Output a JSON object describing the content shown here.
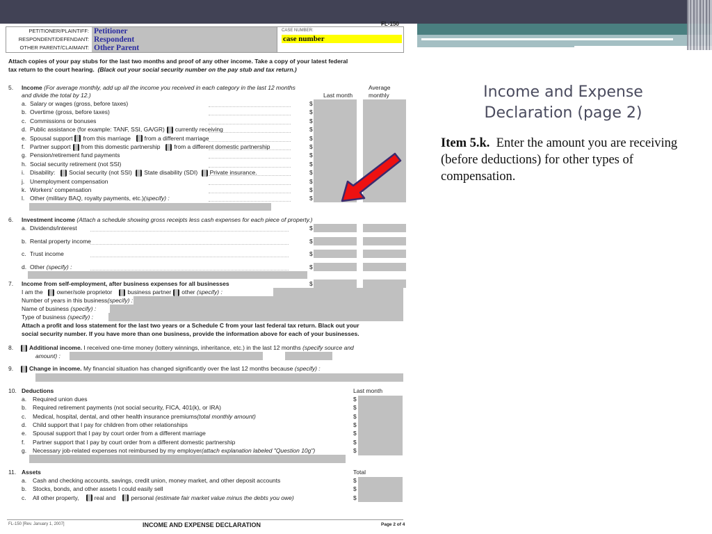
{
  "form": {
    "form_id": "FL-150",
    "header": {
      "labels": [
        "PETITIONER/PLAINTIFF:",
        "RESPONDENT/DEFENDANT:",
        "OTHER PARENT/CLAIMANT:"
      ],
      "values": [
        "Petitioner",
        "Respondent",
        "Other Parent"
      ],
      "case_number_label": "CASE NUMBER:",
      "case_number_value": "case number"
    },
    "intro": {
      "line1": "Attach copies of your pay stubs for the last two months and proof of any other income. Take a copy of your latest federal",
      "line2_a": "tax return to the court hearing.",
      "line2_b": "(Black out your social security number on the pay stub and tax return.)"
    },
    "col_headers": {
      "last_month": "Last month",
      "average": "Average",
      "monthly": "monthly",
      "total": "Total"
    },
    "dollar": "$",
    "item5": {
      "num": "5.",
      "title": "Income",
      "note1": "(For average monthly, add up all the income you received in each category in the last 12 months",
      "note2": "and divide the total by 12.)",
      "rows": [
        {
          "letter": "a.",
          "text": "Salary or wages (gross, before taxes)"
        },
        {
          "letter": "b.",
          "text": "Overtime (gross, before taxes)"
        },
        {
          "letter": "c.",
          "text": "Commissions or bonuses"
        },
        {
          "letter": "d.",
          "text": "Public assistance (for example: TANF, SSI, GA/GR)",
          "opt1": "currently receiving"
        },
        {
          "letter": "e.",
          "text": "Spousal support",
          "opt1": "from this marriage",
          "opt2": "from a different marriage"
        },
        {
          "letter": "f.",
          "text": "Partner support",
          "opt1": "from this domestic partnership",
          "opt2": "from a different domestic partnership"
        },
        {
          "letter": "g.",
          "text": "Pension/retirement fund payments"
        },
        {
          "letter": "h.",
          "text": "Social security retirement (not SSI)"
        },
        {
          "letter": "i.",
          "text": "Disability:",
          "opt1": "Social security (not SSI)",
          "opt2": "State disability (SDI)",
          "opt3": "Private insurance."
        },
        {
          "letter": "j.",
          "text": "Unemployment compensation"
        },
        {
          "letter": "k.",
          "text": "Workers' compensation"
        },
        {
          "letter": "l.",
          "text": "Other (military BAQ, royalty payments, etc.)",
          "spec": "(specify) :"
        }
      ]
    },
    "item6": {
      "num": "6.",
      "title": "Investment income",
      "note": "(Attach a schedule showing gross receipts less cash expenses for each piece of property.)",
      "rows": [
        {
          "letter": "a.",
          "text": "Dividends/interest"
        },
        {
          "letter": "b.",
          "text": "Rental property income"
        },
        {
          "letter": "c.",
          "text": "Trust income"
        },
        {
          "letter": "d.",
          "text": "Other",
          "spec": "(specify) :"
        }
      ]
    },
    "item7": {
      "num": "7.",
      "title": "Income from self-employment, after business expenses for all businesses",
      "iam": "I am the",
      "opt1": "owner/sole proprietor",
      "opt2": "business partner",
      "opt3": "other",
      "spec": "(specify) :",
      "years": "Number of years in this business",
      "name": "Name of business",
      "type": "Type of business",
      "attach1": "Attach a profit and loss statement for the last two years or a Schedule C from your last federal tax return. Black out your",
      "attach2": "social security number. If you have more than one business, provide the information above for each of your businesses."
    },
    "item8": {
      "num": "8.",
      "title": "Additional income.",
      "text": "I received one-time money (lottery winnings, inheritance, etc.) in the last 12 months",
      "spec1": "(specify source and",
      "spec2": "amount) :"
    },
    "item9": {
      "num": "9.",
      "title": "Change in income.",
      "text": "My financial situation has changed significantly over the last 12 months because",
      "spec": "(specify) :"
    },
    "item10": {
      "num": "10.",
      "title": "Deductions",
      "rows": [
        {
          "letter": "a.",
          "text": "Required union dues"
        },
        {
          "letter": "b.",
          "text": "Required retirement payments (not social security, FICA, 401(k), or IRA)"
        },
        {
          "letter": "c.",
          "text": "Medical, hospital, dental, and other health insurance premiums",
          "spec": "(total monthly amount)"
        },
        {
          "letter": "d.",
          "text": "Child support that I pay for children from other relationships"
        },
        {
          "letter": "e.",
          "text": "Spousal support that I pay by court order from a different marriage"
        },
        {
          "letter": "f.",
          "text": "Partner support that I pay by court order from a different domestic partnership"
        },
        {
          "letter": "g.",
          "text": "Necessary job-related expenses not reimbursed by my employer",
          "spec": "(attach explanation labeled \"Question 10g\")"
        }
      ]
    },
    "item11": {
      "num": "11.",
      "title": "Assets",
      "rows": [
        {
          "letter": "a.",
          "text": "Cash and checking accounts, savings, credit union, money market, and other deposit accounts"
        },
        {
          "letter": "b.",
          "text": "Stocks, bonds, and other assets I could easily sell"
        },
        {
          "letter": "c.",
          "text": "All other property,",
          "opt1": "real and",
          "opt2": "personal",
          "spec": "(estimate fair market value minus the debts you owe)"
        }
      ]
    },
    "footer": {
      "left": "FL-150 [Rev. January 1, 2007]",
      "center": "INCOME AND EXPENSE DECLARATION",
      "right": "Page 2 of 4"
    }
  },
  "slide": {
    "title_line1": "Income and Expense",
    "title_line2": "Declaration (page 2)",
    "item_label": "Item 5.k.",
    "item_text": "Enter the amount you are receiving (before deductions) for other types of compensation."
  },
  "colors": {
    "topbar": "#414255",
    "teal": "#4a7f80",
    "field_gray": "#c0c0c0",
    "highlight_yellow": "#ffff00",
    "arrow_red": "#ee1111"
  }
}
